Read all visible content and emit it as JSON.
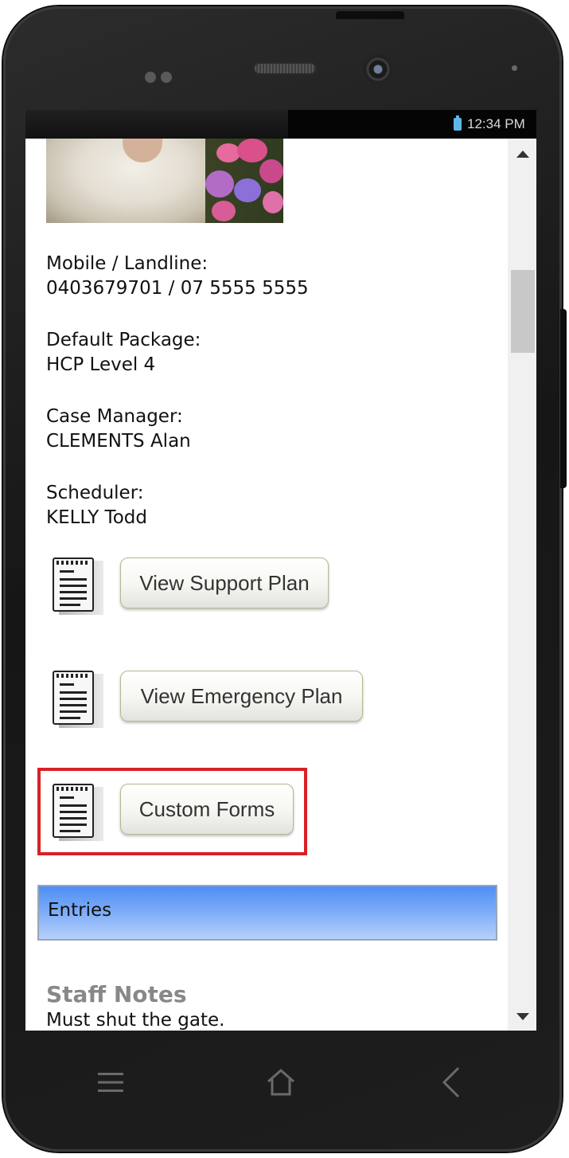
{
  "status_bar": {
    "time": "12:34 PM",
    "battery_icon": "battery-icon"
  },
  "client": {
    "mobile_label": "Mobile / Landline:",
    "mobile_value": "0403679701 / 07 5555 5555",
    "package_label": "Default Package:",
    "package_value": "HCP Level 4",
    "case_manager_label": "Case Manager:",
    "case_manager_value": "CLEMENTS Alan",
    "scheduler_label": "Scheduler:",
    "scheduler_value": "KELLY Todd"
  },
  "actions": {
    "support_plan": "View Support Plan",
    "emergency_plan": "View Emergency Plan",
    "custom_forms": "Custom Forms"
  },
  "entries": {
    "header": "Entries"
  },
  "staff_notes": {
    "title": "Staff Notes",
    "text": "Must shut the gate."
  },
  "nav": {
    "menu_icon": "menu-icon",
    "home_icon": "home-icon",
    "back_icon": "back-icon"
  },
  "colors": {
    "highlight": "#d92027",
    "entries_bar_top": "#4f8ef5",
    "entries_bar_bottom": "#b6d0fb"
  }
}
